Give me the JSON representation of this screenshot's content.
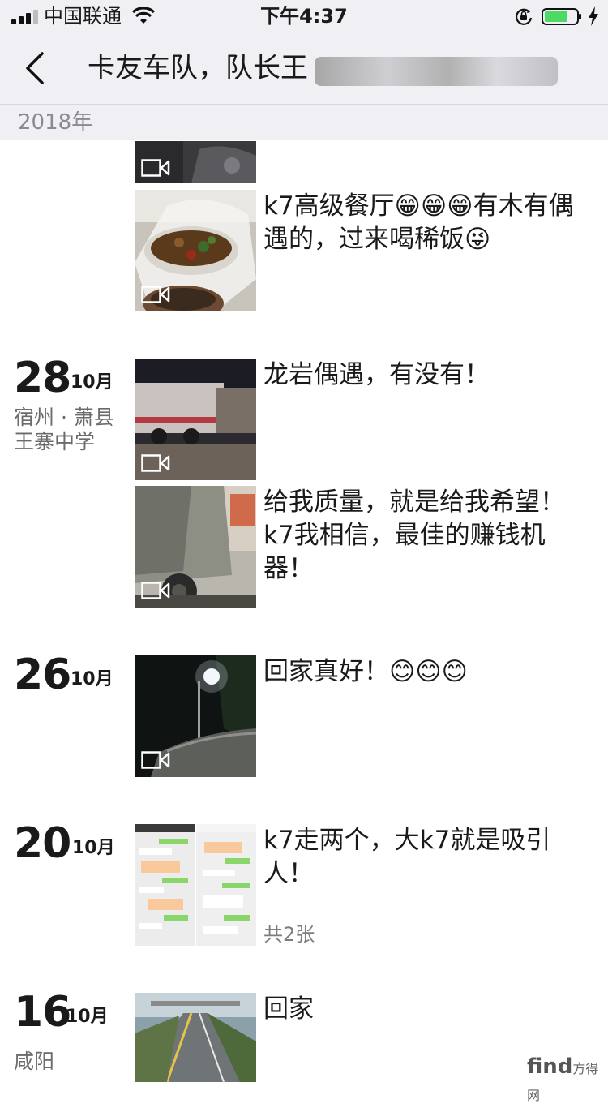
{
  "status_bar": {
    "carrier": "中国联通",
    "time": "下午4:37"
  },
  "nav": {
    "title": "卡友车队，队长王"
  },
  "year": "2018年",
  "posts": [
    {
      "text": "k7高级餐厅😁😁😁有木有偶遇的，过来喝稀饭😜"
    },
    {
      "day": "28",
      "month": "10月",
      "location": "宿州 · 萧县王寨中学",
      "text": "龙岩偶遇，有没有！"
    },
    {
      "text": "给我质量，就是给我希望！k7我相信，最佳的赚钱机器！"
    },
    {
      "day": "26",
      "month": "10月",
      "text": "回家真好！😊😊😊"
    },
    {
      "day": "20",
      "month": "10月",
      "text": "k7走两个，大k7就是吸引人！",
      "count": "共2张"
    },
    {
      "day": "16",
      "month": "10月",
      "location": "咸阳",
      "text": "回家"
    }
  ],
  "watermark": {
    "brand": "find",
    "suffix": "方得网"
  }
}
